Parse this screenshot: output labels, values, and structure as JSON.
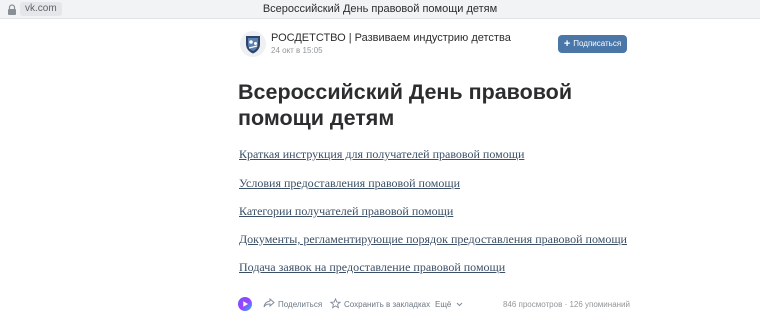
{
  "browser": {
    "url": "vk.com",
    "tab_title": "Всероссийский День правовой помощи детям"
  },
  "author": {
    "name": "РОСДЕТСТВО | Развиваем индустрию детства",
    "date": "24 окт в 15:05"
  },
  "subscribe_label": "Подписаться",
  "article": {
    "title": "Всероссийский День правовой помощи детям",
    "links": [
      "Краткая инструкция для получателей правовой помощи",
      "Условия предоставления правовой помощи",
      "Категории получателей правовой помощи",
      "Документы, регламентирующие порядок предоставления правовой помощи",
      "Подача заявок на предоставление правовой помощи"
    ]
  },
  "footer": {
    "share": "Поделиться",
    "save": "Сохранить в закладках",
    "more": "Ещё",
    "views": "846 просмотров",
    "mentions": "126 упоминаний"
  },
  "colors": {
    "accent": "#4a76a8",
    "link": "#3b4f66"
  }
}
